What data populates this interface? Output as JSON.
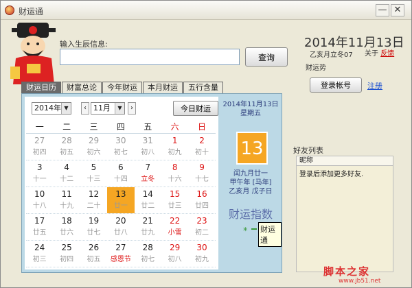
{
  "window": {
    "title": "财运通",
    "minimize": "—",
    "close": "✕"
  },
  "search": {
    "label": "输入生辰信息:",
    "value": "",
    "placeholder": "",
    "button": "查询"
  },
  "header": {
    "date": "2014年11月13日",
    "lunar": "乙亥月立冬07",
    "about": "关于",
    "feedback": "反馈",
    "fortune_label": "财运势",
    "login_button": "登录帐号",
    "register_link": "注册"
  },
  "tabs": [
    "财运日历",
    "财富总论",
    "今年财运",
    "本月财运",
    "五行含量"
  ],
  "active_tab": 0,
  "calendar": {
    "year_select": "2014年",
    "month_select": "11月",
    "prev": "‹",
    "next": "›",
    "today_button": "今日财运",
    "weekdays": [
      "一",
      "二",
      "三",
      "四",
      "五",
      "六",
      "日"
    ],
    "weekday_colors": [
      "#222",
      "#222",
      "#222",
      "#222",
      "#222",
      "#d11",
      "#d11"
    ],
    "weeks": [
      [
        {
          "d": "27",
          "l": "初四",
          "g": true
        },
        {
          "d": "28",
          "l": "初五",
          "g": true
        },
        {
          "d": "29",
          "l": "初六",
          "g": true
        },
        {
          "d": "30",
          "l": "初七",
          "g": true
        },
        {
          "d": "31",
          "l": "初八",
          "g": true
        },
        {
          "d": "1",
          "l": "初九",
          "r": true
        },
        {
          "d": "2",
          "l": "初十",
          "r": true
        }
      ],
      [
        {
          "d": "3",
          "l": "十一"
        },
        {
          "d": "4",
          "l": "十二"
        },
        {
          "d": "5",
          "l": "十三"
        },
        {
          "d": "6",
          "l": "十四"
        },
        {
          "d": "7",
          "l": "立冬",
          "lr": true
        },
        {
          "d": "8",
          "l": "十六",
          "r": true
        },
        {
          "d": "9",
          "l": "十七",
          "r": true
        }
      ],
      [
        {
          "d": "10",
          "l": "十八"
        },
        {
          "d": "11",
          "l": "十九"
        },
        {
          "d": "12",
          "l": "二十"
        },
        {
          "d": "13",
          "l": "廿一",
          "sel": true
        },
        {
          "d": "14",
          "l": "廿二"
        },
        {
          "d": "15",
          "l": "廿三",
          "r": true
        },
        {
          "d": "16",
          "l": "廿四",
          "r": true
        }
      ],
      [
        {
          "d": "17",
          "l": "廿五"
        },
        {
          "d": "18",
          "l": "廿六"
        },
        {
          "d": "19",
          "l": "廿七"
        },
        {
          "d": "20",
          "l": "廿八"
        },
        {
          "d": "21",
          "l": "廿九"
        },
        {
          "d": "22",
          "l": "小雪",
          "r": true,
          "lr": true
        },
        {
          "d": "23",
          "l": "初二",
          "r": true
        }
      ],
      [
        {
          "d": "24",
          "l": "初三"
        },
        {
          "d": "25",
          "l": "初四"
        },
        {
          "d": "26",
          "l": "初五"
        },
        {
          "d": "27",
          "l": "感恩节",
          "lr": true
        },
        {
          "d": "28",
          "l": "初七"
        },
        {
          "d": "29",
          "l": "初八",
          "r": true
        },
        {
          "d": "30",
          "l": "初九",
          "r": true
        }
      ]
    ]
  },
  "detail": {
    "date": "2014年11月13日",
    "weekday": "星期五",
    "day_number": "13",
    "lunar_lines": [
      "闰九月廿一",
      "甲午年 [马年]",
      "乙亥月 戊子日"
    ],
    "index_title": "财运指数",
    "index_star": "*",
    "tooltip": "财运通"
  },
  "friends": {
    "title": "好友列表",
    "column": "昵称",
    "message": "登录后添加更多好友."
  },
  "watermark": {
    "text": "脚本之家",
    "url": "www.jb51.net"
  }
}
